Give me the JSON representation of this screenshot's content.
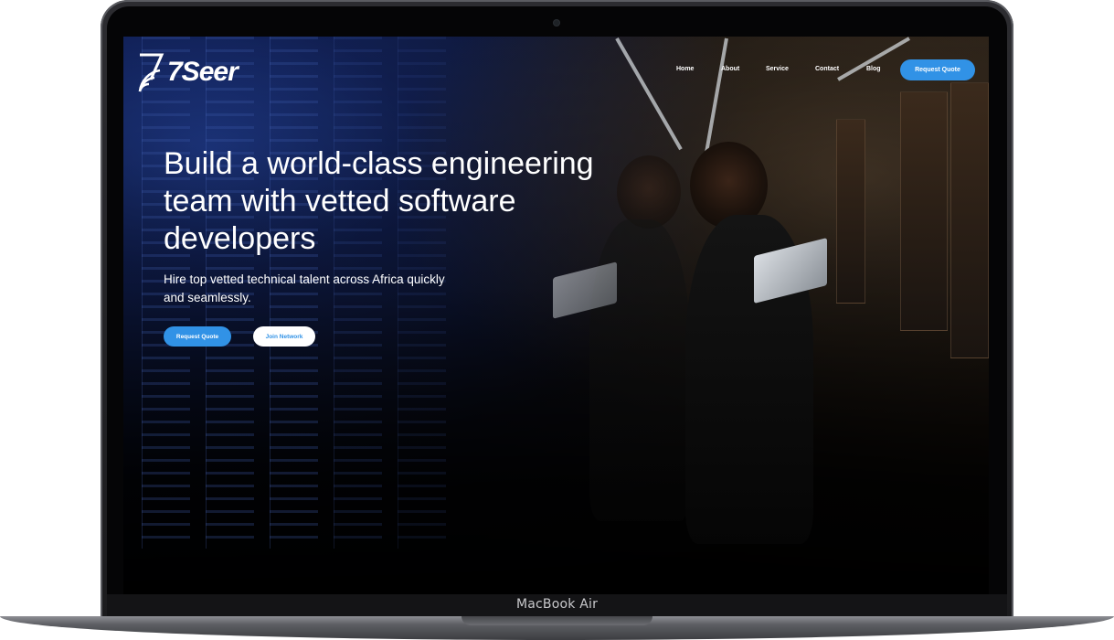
{
  "device": {
    "label": "MacBook Air"
  },
  "site": {
    "logo_text": "7Seer",
    "nav": {
      "items": [
        {
          "label": "Home"
        },
        {
          "label": "About"
        },
        {
          "label": "Service"
        },
        {
          "label": "Contact"
        },
        {
          "label": "Blog"
        }
      ],
      "cta_label": "Request Quote"
    },
    "hero": {
      "title": "Build a world-class engineering team with vetted software developers",
      "subtitle": "Hire top vetted technical talent across Africa quickly and seamlessly.",
      "primary_button": "Request Quote",
      "secondary_button": "Join Network"
    },
    "colors": {
      "accent": "#3192e6",
      "text_on_dark": "#ffffff"
    }
  }
}
